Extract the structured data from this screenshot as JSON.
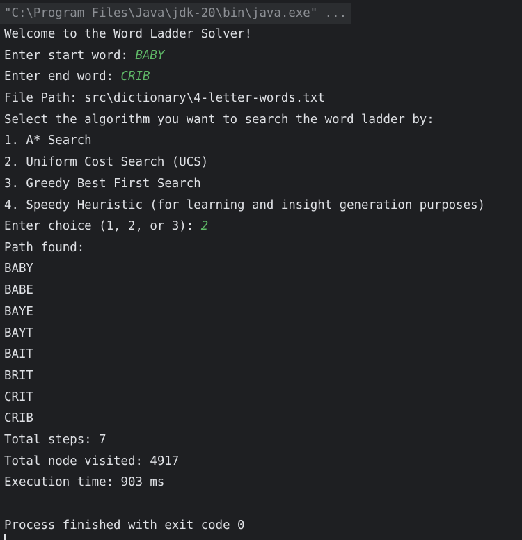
{
  "console": {
    "command": "\"C:\\Program Files\\Java\\jdk-20\\bin\\java.exe\" ...",
    "welcome": "Welcome to the Word Ladder Solver!",
    "start_prompt": "Enter start word: ",
    "start_value": "BABY",
    "end_prompt": "Enter end word: ",
    "end_value": "CRIB",
    "file_path": "File Path: src\\dictionary\\4-letter-words.txt",
    "select_prompt": "Select the algorithm you want to search the word ladder by:",
    "options": [
      "1. A* Search",
      "2. Uniform Cost Search (UCS)",
      "3. Greedy Best First Search",
      "4. Speedy Heuristic (for learning and insight generation purposes)"
    ],
    "choice_prompt": "Enter choice (1, 2, or 3): ",
    "choice_value": "2",
    "path_found": "Path found:",
    "path": [
      "BABY",
      "BABE",
      "BAYE",
      "BAYT",
      "BAIT",
      "BRIT",
      "CRIT",
      "CRIB"
    ],
    "total_steps": "Total steps: 7",
    "nodes_visited": "Total node visited: 4917",
    "execution_time": "Execution time: 903 ms",
    "exit_message": "Process finished with exit code 0"
  },
  "colors": {
    "background": "#1e1f22",
    "text": "#dfe1e5",
    "command_text": "#8c8f94",
    "user_input": "#5fb867"
  }
}
